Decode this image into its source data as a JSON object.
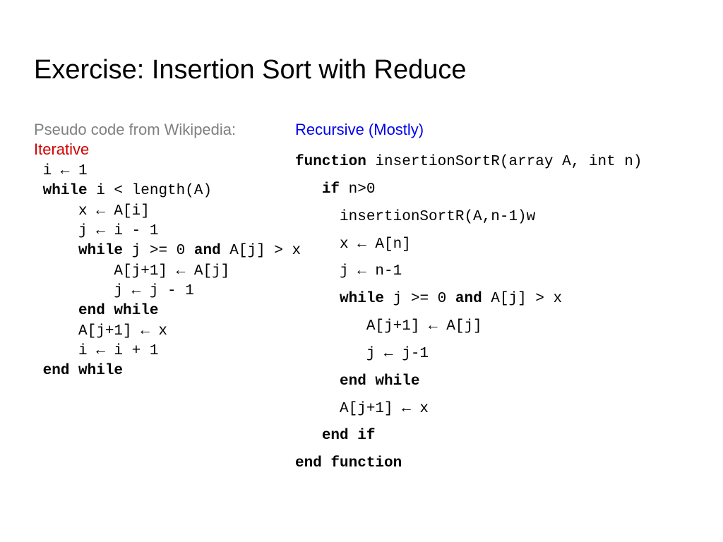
{
  "title": "Exercise: Insertion Sort with Reduce",
  "left": {
    "src_label": "Pseudo code from Wikipedia:",
    "variant_label": "Iterative",
    "lines": [
      [
        {
          "t": " i ← 1",
          "b": false
        }
      ],
      [
        {
          "t": " ",
          "b": false
        },
        {
          "t": "while",
          "b": true
        },
        {
          "t": " i < length(A)",
          "b": false
        }
      ],
      [
        {
          "t": "     x ← A[i]",
          "b": false
        }
      ],
      [
        {
          "t": "     j ← i - 1",
          "b": false
        }
      ],
      [
        {
          "t": "     ",
          "b": false
        },
        {
          "t": "while",
          "b": true
        },
        {
          "t": " j >= 0 ",
          "b": false
        },
        {
          "t": "and",
          "b": true
        },
        {
          "t": " A[j] > x",
          "b": false
        }
      ],
      [
        {
          "t": "         A[j+1] ← A[j]",
          "b": false
        }
      ],
      [
        {
          "t": "         j ← j - 1",
          "b": false
        }
      ],
      [
        {
          "t": "     ",
          "b": false
        },
        {
          "t": "end while",
          "b": true
        }
      ],
      [
        {
          "t": "     A[j+1] ← x",
          "b": false
        }
      ],
      [
        {
          "t": "     i ← i + 1",
          "b": false
        }
      ],
      [
        {
          "t": " ",
          "b": false
        },
        {
          "t": "end while",
          "b": true
        }
      ]
    ]
  },
  "right": {
    "variant_label": "Recursive (Mostly)",
    "lines": [
      [
        {
          "t": "function",
          "b": true
        },
        {
          "t": " insertionSortR(array A, int n)",
          "b": false
        }
      ],
      [
        {
          "t": "   ",
          "b": false
        },
        {
          "t": "if",
          "b": true
        },
        {
          "t": " n>0",
          "b": false
        }
      ],
      [
        {
          "t": "     insertionSortR(A,n-1)w",
          "b": false
        }
      ],
      [
        {
          "t": "     x ← A[n]",
          "b": false
        }
      ],
      [
        {
          "t": "     j ← n-1",
          "b": false
        }
      ],
      [
        {
          "t": "     ",
          "b": false
        },
        {
          "t": "while",
          "b": true
        },
        {
          "t": " j >= 0 ",
          "b": false
        },
        {
          "t": "and",
          "b": true
        },
        {
          "t": " A[j] > x",
          "b": false
        }
      ],
      [
        {
          "t": "        A[j+1] ← A[j]",
          "b": false
        }
      ],
      [
        {
          "t": "        j ← j-1",
          "b": false
        }
      ],
      [
        {
          "t": "     ",
          "b": false
        },
        {
          "t": "end while",
          "b": true
        }
      ],
      [
        {
          "t": "     A[j+1] ← x",
          "b": false
        }
      ],
      [
        {
          "t": "   ",
          "b": false
        },
        {
          "t": "end if",
          "b": true
        }
      ],
      [
        {
          "t": "end function",
          "b": true
        }
      ]
    ]
  }
}
